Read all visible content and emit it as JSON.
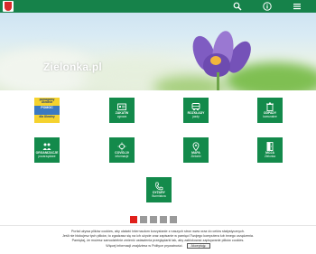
{
  "site": {
    "name": "Zielonka.pl",
    "brand_color": "#16824a",
    "tile_color": "#138a4b"
  },
  "topbar": {
    "icons": [
      "search-icon",
      "info-icon",
      "hamburger-menu-icon"
    ]
  },
  "tiles": {
    "pomoc": {
      "line1": "pomagamy Ukrainie",
      "line2": "POMOC",
      "line3": "dla Ukrainy",
      "colors": {
        "blue": "#3b79c2",
        "yellow": "#f5d22e"
      }
    },
    "zakaty": {
      "label": "ZAKATW",
      "sub": "zgrowa"
    },
    "rozklady": {
      "label": "ROZKŁADY",
      "sub": "jazdy"
    },
    "odpady": {
      "label": "ODPADY",
      "sub": "komunalne"
    },
    "organizacje": {
      "label": "ORGANIZACJE",
      "sub": "pozarządowe"
    },
    "covid": {
      "label": "COVID-19",
      "sub": "informacje"
    },
    "mapa": {
      "label": "MAPA",
      "sub": "Zielonki"
    },
    "moja": {
      "label": "MOJA",
      "sub": "Zielonka"
    },
    "dyzury": {
      "label": "DYŻURY",
      "sub": "Burmistrza"
    }
  },
  "carousel": {
    "total": 5,
    "active": 1,
    "active_color": "#e0201b"
  },
  "cookie": {
    "line1": "Portal używa plików cookies, aby ułatwić Internautom korzystanie z naszych stron www oraz do celów statystycznych.",
    "line2": "Jeśli nie blokujesz tych plików, to zgadzasz się na ich użycie oraz zapisanie w pamięci Twojego komputera lub innego urządzenia.",
    "line3": "Pamiętaj, że możesz samodzielnie zmienić ustawienia przeglądarki tak, aby zablokować zapisywanie plików cookies.",
    "line4": "Więcej informacji znajdziesz w Polityce prywatności.",
    "accept": "Akceptuję"
  }
}
